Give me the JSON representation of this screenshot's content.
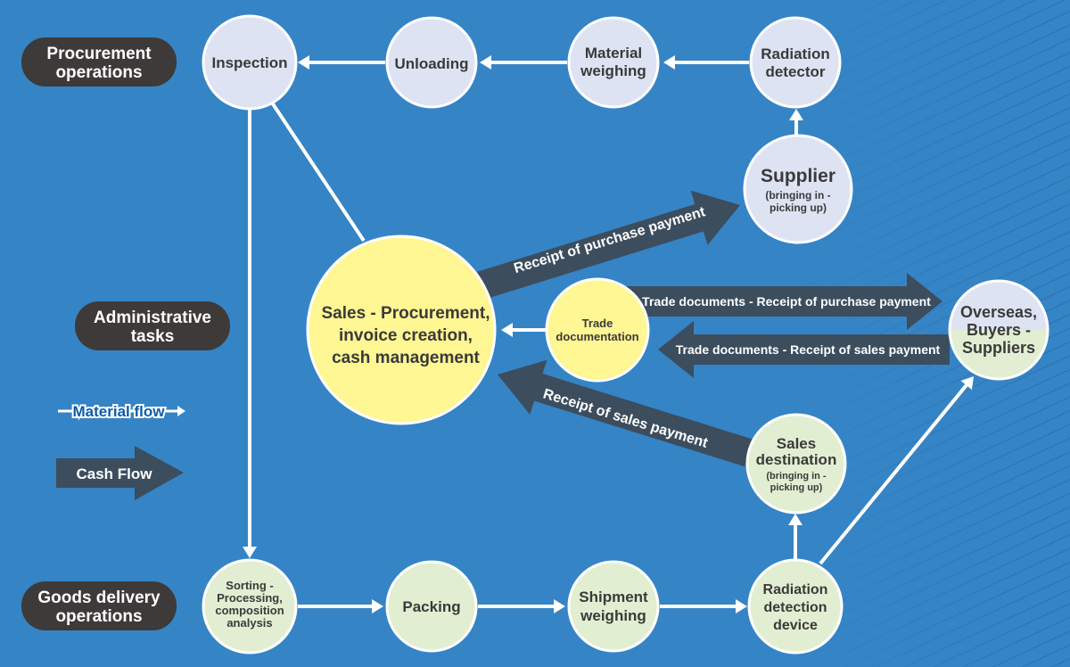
{
  "colors": {
    "background": "#3584c6",
    "procurement_node": "#dde3f3",
    "admin_node": "#fff694",
    "delivery_node": "#e2eed2",
    "cash_arrow": "#3c4d5e",
    "section_pill": "#3e3a39",
    "material_flow": "#ffffff"
  },
  "sections": {
    "procurement": [
      "Procurement",
      "operations"
    ],
    "administrative": [
      "Administrative",
      "tasks"
    ],
    "delivery": [
      "Goods delivery",
      "operations"
    ]
  },
  "legend": {
    "material_flow": "Material flow",
    "cash_flow": "Cash Flow"
  },
  "nodes": {
    "inspection": [
      "Inspection"
    ],
    "unloading": [
      "Unloading"
    ],
    "material_weighing": [
      "Material",
      "weighing"
    ],
    "radiation_detector": [
      "Radiation",
      "detector"
    ],
    "supplier": {
      "title": "Supplier",
      "sub": [
        "(bringing in -",
        "picking up)"
      ]
    },
    "sales_procurement": [
      "Sales - Procurement,",
      "invoice creation,",
      "cash management"
    ],
    "trade_documentation": [
      "Trade",
      "documentation"
    ],
    "overseas": [
      "Overseas,",
      "Buyers -",
      "Suppliers"
    ],
    "sales_destination": {
      "title": [
        "Sales",
        "destination"
      ],
      "sub": [
        "(bringing in -",
        "picking up)"
      ]
    },
    "sorting": [
      "Sorting -",
      "Processing,",
      "composition",
      "analysis"
    ],
    "packing": [
      "Packing"
    ],
    "shipment_weighing": [
      "Shipment",
      "weighing"
    ],
    "radiation_device": [
      "Radiation",
      "detection",
      "device"
    ]
  },
  "cash_flows": {
    "purchase_payment": "Receipt of purchase payment",
    "trade_docs_purchase": "Trade documents - Receipt of purchase payment",
    "trade_docs_sales": "Trade documents - Receipt of sales payment",
    "sales_payment": "Receipt of sales payment"
  }
}
